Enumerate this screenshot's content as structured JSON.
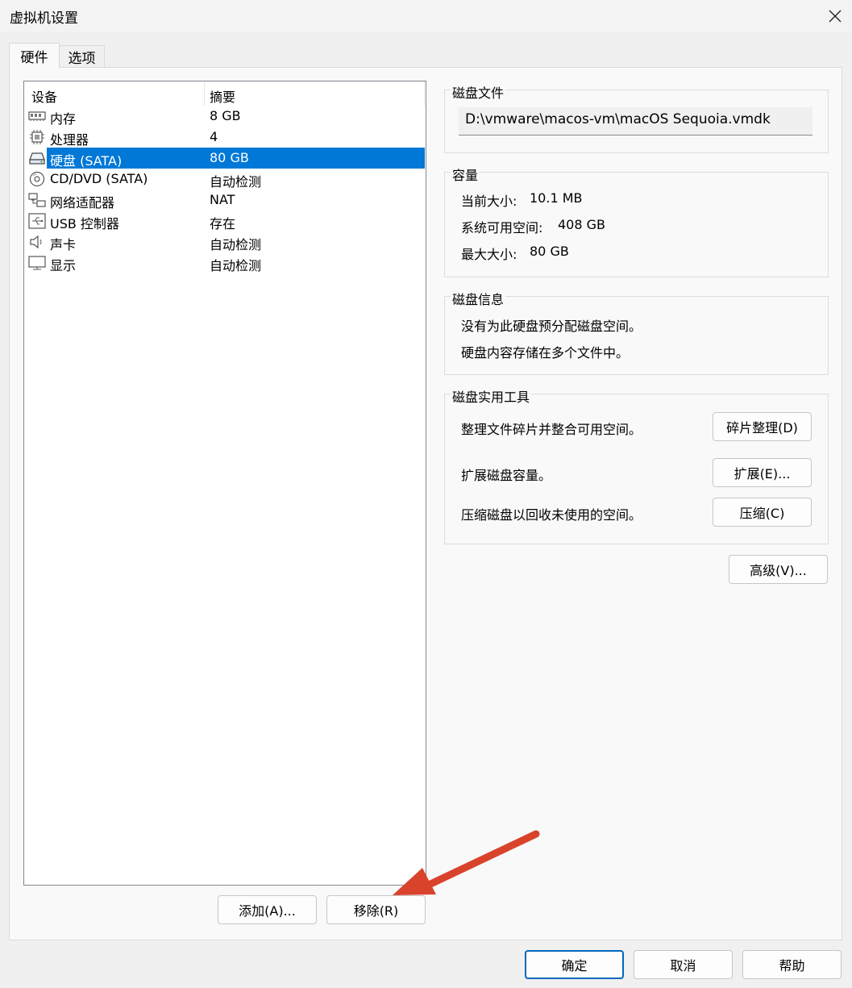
{
  "window": {
    "title": "虚拟机设置"
  },
  "tabs": [
    {
      "label": "硬件"
    },
    {
      "label": "选项"
    }
  ],
  "device_list": {
    "columns": [
      "设备",
      "摘要"
    ],
    "rows": [
      {
        "name": "内存",
        "summary": "8 GB",
        "icon": "memory-icon"
      },
      {
        "name": "处理器",
        "summary": "4",
        "icon": "processor-icon"
      },
      {
        "name": "硬盘 (SATA)",
        "summary": "80 GB",
        "icon": "hard-disk-icon",
        "selected": true
      },
      {
        "name": "CD/DVD (SATA)",
        "summary": "自动检测",
        "icon": "cd-dvd-icon"
      },
      {
        "name": "网络适配器",
        "summary": "NAT",
        "icon": "network-adapter-icon"
      },
      {
        "name": "USB 控制器",
        "summary": "存在",
        "icon": "usb-icon"
      },
      {
        "name": "声卡",
        "summary": "自动检测",
        "icon": "sound-card-icon"
      },
      {
        "name": "显示",
        "summary": "自动检测",
        "icon": "display-icon"
      }
    ]
  },
  "list_buttons": {
    "add": "添加(A)...",
    "remove": "移除(R)"
  },
  "disk_file": {
    "title": "磁盘文件",
    "path": "D:\\vmware\\macos-vm\\macOS Sequoia.vmdk"
  },
  "capacity": {
    "title": "容量",
    "current_label": "当前大小:",
    "current_value": "10.1 MB",
    "available_label": "系统可用空间:",
    "available_value": "408 GB",
    "max_label": "最大大小:",
    "max_value": "80 GB"
  },
  "disk_info": {
    "title": "磁盘信息",
    "line1": "没有为此硬盘预分配磁盘空间。",
    "line2": "硬盘内容存储在多个文件中。"
  },
  "disk_utilities": {
    "title": "磁盘实用工具",
    "defrag_text": "整理文件碎片并整合可用空间。",
    "defrag_button": "碎片整理(D)",
    "expand_text": "扩展磁盘容量。",
    "expand_button": "扩展(E)...",
    "compact_text": "压缩磁盘以回收未使用的空间。",
    "compact_button": "压缩(C)"
  },
  "advanced_button": "高级(V)...",
  "footer": {
    "ok": "确定",
    "cancel": "取消",
    "help": "帮助"
  },
  "colors": {
    "selection": "#0078d7",
    "annotation_arrow": "#d9432c",
    "primary_border": "#0067c0"
  }
}
